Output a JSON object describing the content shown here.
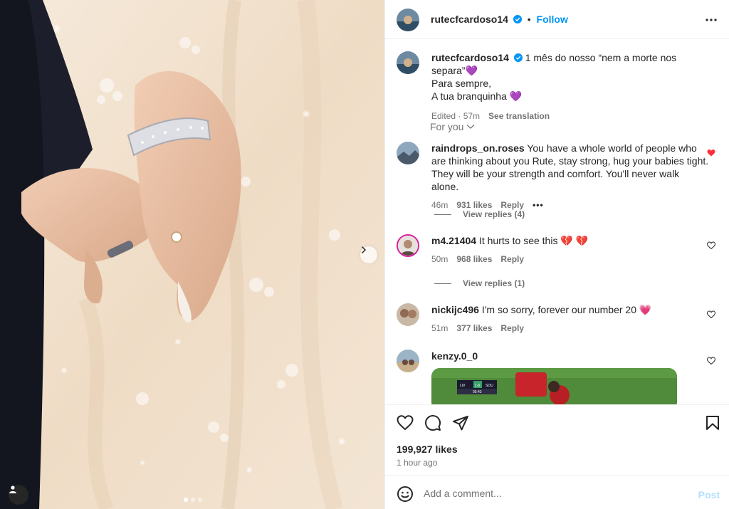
{
  "post": {
    "author": "rutecfcardoso14",
    "follow_label": "Follow",
    "separator": "•",
    "caption": {
      "line1": "1 mês do nosso “nem a morte nos separa”",
      "emoji1": "💜",
      "line2": "Para sempre,",
      "line3": "A tua branquinha",
      "emoji3": "💜",
      "edited": "Edited · 57m",
      "see_translation": "See translation"
    },
    "for_you": "For you",
    "likes": "199,927 likes",
    "time": "1 hour ago",
    "add_comment_placeholder": "Add a comment...",
    "post_label": "Post"
  },
  "comments": [
    {
      "user": "raindrops_on.roses",
      "text": "You have a whole world of people who are thinking about you Rute, stay strong, hug your babies tight. They will be your strength and comfort. You'll never walk alone.",
      "time": "46m",
      "likes": "931 likes",
      "reply": "Reply",
      "more": "•••",
      "liked": true,
      "view_replies": "View replies (4)"
    },
    {
      "user": "m4.21404",
      "text": "It hurts to see this 💔 💔",
      "time": "50m",
      "likes": "968 likes",
      "reply": "Reply",
      "liked": false,
      "view_replies": "View replies (1)"
    },
    {
      "user": "nickijc496",
      "text": "I'm so sorry, forever our number 20 💗",
      "time": "51m",
      "likes": "377 likes",
      "reply": "Reply",
      "liked": false
    },
    {
      "user": "kenzy.0_0",
      "text": "",
      "liked": false,
      "scoreboard": {
        "home": "LIV",
        "score": "1-0",
        "away": "SOU",
        "clock": "05:43"
      }
    }
  ],
  "colors": {
    "accent": "#0095f6",
    "liked_heart": "#ff3040",
    "post_disabled": "#b2dffc"
  },
  "icons": [
    "next-icon",
    "tag-user-icon",
    "more-options-icon",
    "heart-icon",
    "comment-icon",
    "share-icon",
    "bookmark-icon",
    "emoji-icon",
    "verified-icon",
    "chevron-down-icon"
  ]
}
